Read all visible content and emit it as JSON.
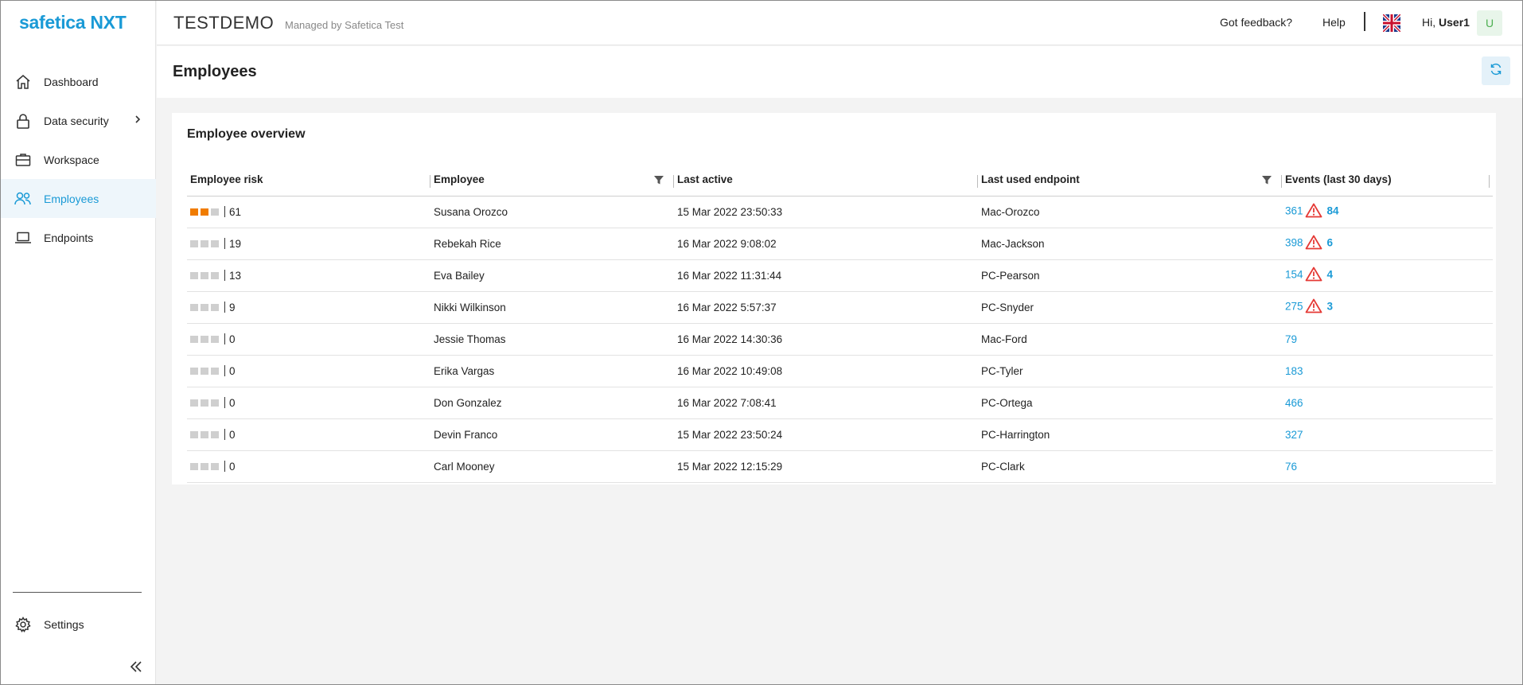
{
  "app": {
    "logo_text": "safetica",
    "logo_suffix": "NXT"
  },
  "sidebar": {
    "items": [
      {
        "label": "Dashboard",
        "icon": "home-icon"
      },
      {
        "label": "Data security",
        "icon": "lock-icon"
      },
      {
        "label": "Workspace",
        "icon": "briefcase-icon"
      },
      {
        "label": "Employees",
        "icon": "users-icon"
      },
      {
        "label": "Endpoints",
        "icon": "laptop-icon"
      }
    ],
    "settings_label": "Settings"
  },
  "header": {
    "tenant": "TESTDEMO",
    "managed_by": "Managed by Safetica Test",
    "feedback_label": "Got feedback?",
    "help_label": "Help",
    "greeting": "Hi,",
    "user_name": "User1",
    "avatar_initial": "U"
  },
  "page": {
    "title": "Employees"
  },
  "card": {
    "title": "Employee overview",
    "columns": [
      "Employee risk",
      "Employee",
      "Last active",
      "Last used endpoint",
      "Events (last 30 days)"
    ],
    "rows": [
      {
        "risk_level": 2,
        "risk": "61",
        "employee": "Susana Orozco",
        "last_active": "15 Mar 2022 23:50:33",
        "endpoint": "Mac-Orozco",
        "events": "361",
        "alerts": "84"
      },
      {
        "risk_level": 0,
        "risk": "19",
        "employee": "Rebekah Rice",
        "last_active": "16 Mar 2022 9:08:02",
        "endpoint": "Mac-Jackson",
        "events": "398",
        "alerts": "6"
      },
      {
        "risk_level": 0,
        "risk": "13",
        "employee": "Eva Bailey",
        "last_active": "16 Mar 2022 11:31:44",
        "endpoint": "PC-Pearson",
        "events": "154",
        "alerts": "4"
      },
      {
        "risk_level": 0,
        "risk": "9",
        "employee": "Nikki Wilkinson",
        "last_active": "16 Mar 2022 5:57:37",
        "endpoint": "PC-Snyder",
        "events": "275",
        "alerts": "3"
      },
      {
        "risk_level": 0,
        "risk": "0",
        "employee": "Jessie Thomas",
        "last_active": "16 Mar 2022 14:30:36",
        "endpoint": "Mac-Ford",
        "events": "79",
        "alerts": ""
      },
      {
        "risk_level": 0,
        "risk": "0",
        "employee": "Erika Vargas",
        "last_active": "16 Mar 2022 10:49:08",
        "endpoint": "PC-Tyler",
        "events": "183",
        "alerts": ""
      },
      {
        "risk_level": 0,
        "risk": "0",
        "employee": "Don Gonzalez",
        "last_active": "16 Mar 2022 7:08:41",
        "endpoint": "PC-Ortega",
        "events": "466",
        "alerts": ""
      },
      {
        "risk_level": 0,
        "risk": "0",
        "employee": "Devin Franco",
        "last_active": "15 Mar 2022 23:50:24",
        "endpoint": "PC-Harrington",
        "events": "327",
        "alerts": ""
      },
      {
        "risk_level": 0,
        "risk": "0",
        "employee": "Carl Mooney",
        "last_active": "15 Mar 2022 12:15:29",
        "endpoint": "PC-Clark",
        "events": "76",
        "alerts": ""
      }
    ]
  },
  "colors": {
    "accent": "#1a9ad6",
    "risk_on": "#f07c00",
    "risk_off": "#cfcfcf",
    "warning": "#e53935"
  }
}
